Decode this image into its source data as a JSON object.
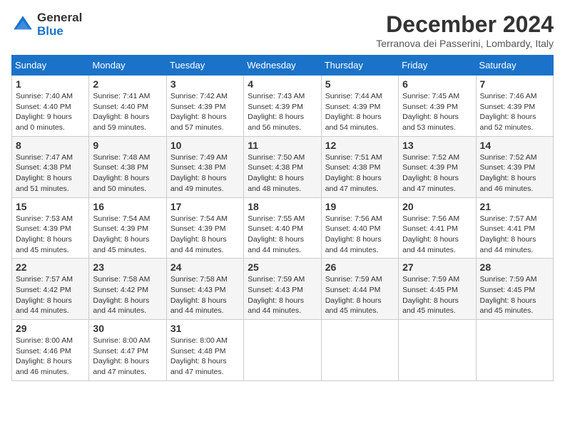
{
  "logo": {
    "general": "General",
    "blue": "Blue"
  },
  "title": "December 2024",
  "location": "Terranova dei Passerini, Lombardy, Italy",
  "days": [
    "Sunday",
    "Monday",
    "Tuesday",
    "Wednesday",
    "Thursday",
    "Friday",
    "Saturday"
  ],
  "weeks": [
    [
      {
        "day": "1",
        "sunrise": "7:40 AM",
        "sunset": "4:40 PM",
        "daylight": "9 hours and 0 minutes."
      },
      {
        "day": "2",
        "sunrise": "7:41 AM",
        "sunset": "4:40 PM",
        "daylight": "8 hours and 59 minutes."
      },
      {
        "day": "3",
        "sunrise": "7:42 AM",
        "sunset": "4:39 PM",
        "daylight": "8 hours and 57 minutes."
      },
      {
        "day": "4",
        "sunrise": "7:43 AM",
        "sunset": "4:39 PM",
        "daylight": "8 hours and 56 minutes."
      },
      {
        "day": "5",
        "sunrise": "7:44 AM",
        "sunset": "4:39 PM",
        "daylight": "8 hours and 54 minutes."
      },
      {
        "day": "6",
        "sunrise": "7:45 AM",
        "sunset": "4:39 PM",
        "daylight": "8 hours and 53 minutes."
      },
      {
        "day": "7",
        "sunrise": "7:46 AM",
        "sunset": "4:39 PM",
        "daylight": "8 hours and 52 minutes."
      }
    ],
    [
      {
        "day": "8",
        "sunrise": "7:47 AM",
        "sunset": "4:38 PM",
        "daylight": "8 hours and 51 minutes."
      },
      {
        "day": "9",
        "sunrise": "7:48 AM",
        "sunset": "4:38 PM",
        "daylight": "8 hours and 50 minutes."
      },
      {
        "day": "10",
        "sunrise": "7:49 AM",
        "sunset": "4:38 PM",
        "daylight": "8 hours and 49 minutes."
      },
      {
        "day": "11",
        "sunrise": "7:50 AM",
        "sunset": "4:38 PM",
        "daylight": "8 hours and 48 minutes."
      },
      {
        "day": "12",
        "sunrise": "7:51 AM",
        "sunset": "4:38 PM",
        "daylight": "8 hours and 47 minutes."
      },
      {
        "day": "13",
        "sunrise": "7:52 AM",
        "sunset": "4:39 PM",
        "daylight": "8 hours and 47 minutes."
      },
      {
        "day": "14",
        "sunrise": "7:52 AM",
        "sunset": "4:39 PM",
        "daylight": "8 hours and 46 minutes."
      }
    ],
    [
      {
        "day": "15",
        "sunrise": "7:53 AM",
        "sunset": "4:39 PM",
        "daylight": "8 hours and 45 minutes."
      },
      {
        "day": "16",
        "sunrise": "7:54 AM",
        "sunset": "4:39 PM",
        "daylight": "8 hours and 45 minutes."
      },
      {
        "day": "17",
        "sunrise": "7:54 AM",
        "sunset": "4:39 PM",
        "daylight": "8 hours and 44 minutes."
      },
      {
        "day": "18",
        "sunrise": "7:55 AM",
        "sunset": "4:40 PM",
        "daylight": "8 hours and 44 minutes."
      },
      {
        "day": "19",
        "sunrise": "7:56 AM",
        "sunset": "4:40 PM",
        "daylight": "8 hours and 44 minutes."
      },
      {
        "day": "20",
        "sunrise": "7:56 AM",
        "sunset": "4:41 PM",
        "daylight": "8 hours and 44 minutes."
      },
      {
        "day": "21",
        "sunrise": "7:57 AM",
        "sunset": "4:41 PM",
        "daylight": "8 hours and 44 minutes."
      }
    ],
    [
      {
        "day": "22",
        "sunrise": "7:57 AM",
        "sunset": "4:42 PM",
        "daylight": "8 hours and 44 minutes."
      },
      {
        "day": "23",
        "sunrise": "7:58 AM",
        "sunset": "4:42 PM",
        "daylight": "8 hours and 44 minutes."
      },
      {
        "day": "24",
        "sunrise": "7:58 AM",
        "sunset": "4:43 PM",
        "daylight": "8 hours and 44 minutes."
      },
      {
        "day": "25",
        "sunrise": "7:59 AM",
        "sunset": "4:43 PM",
        "daylight": "8 hours and 44 minutes."
      },
      {
        "day": "26",
        "sunrise": "7:59 AM",
        "sunset": "4:44 PM",
        "daylight": "8 hours and 45 minutes."
      },
      {
        "day": "27",
        "sunrise": "7:59 AM",
        "sunset": "4:45 PM",
        "daylight": "8 hours and 45 minutes."
      },
      {
        "day": "28",
        "sunrise": "7:59 AM",
        "sunset": "4:45 PM",
        "daylight": "8 hours and 45 minutes."
      }
    ],
    [
      {
        "day": "29",
        "sunrise": "8:00 AM",
        "sunset": "4:46 PM",
        "daylight": "8 hours and 46 minutes."
      },
      {
        "day": "30",
        "sunrise": "8:00 AM",
        "sunset": "4:47 PM",
        "daylight": "8 hours and 47 minutes."
      },
      {
        "day": "31",
        "sunrise": "8:00 AM",
        "sunset": "4:48 PM",
        "daylight": "8 hours and 47 minutes."
      },
      null,
      null,
      null,
      null
    ]
  ]
}
